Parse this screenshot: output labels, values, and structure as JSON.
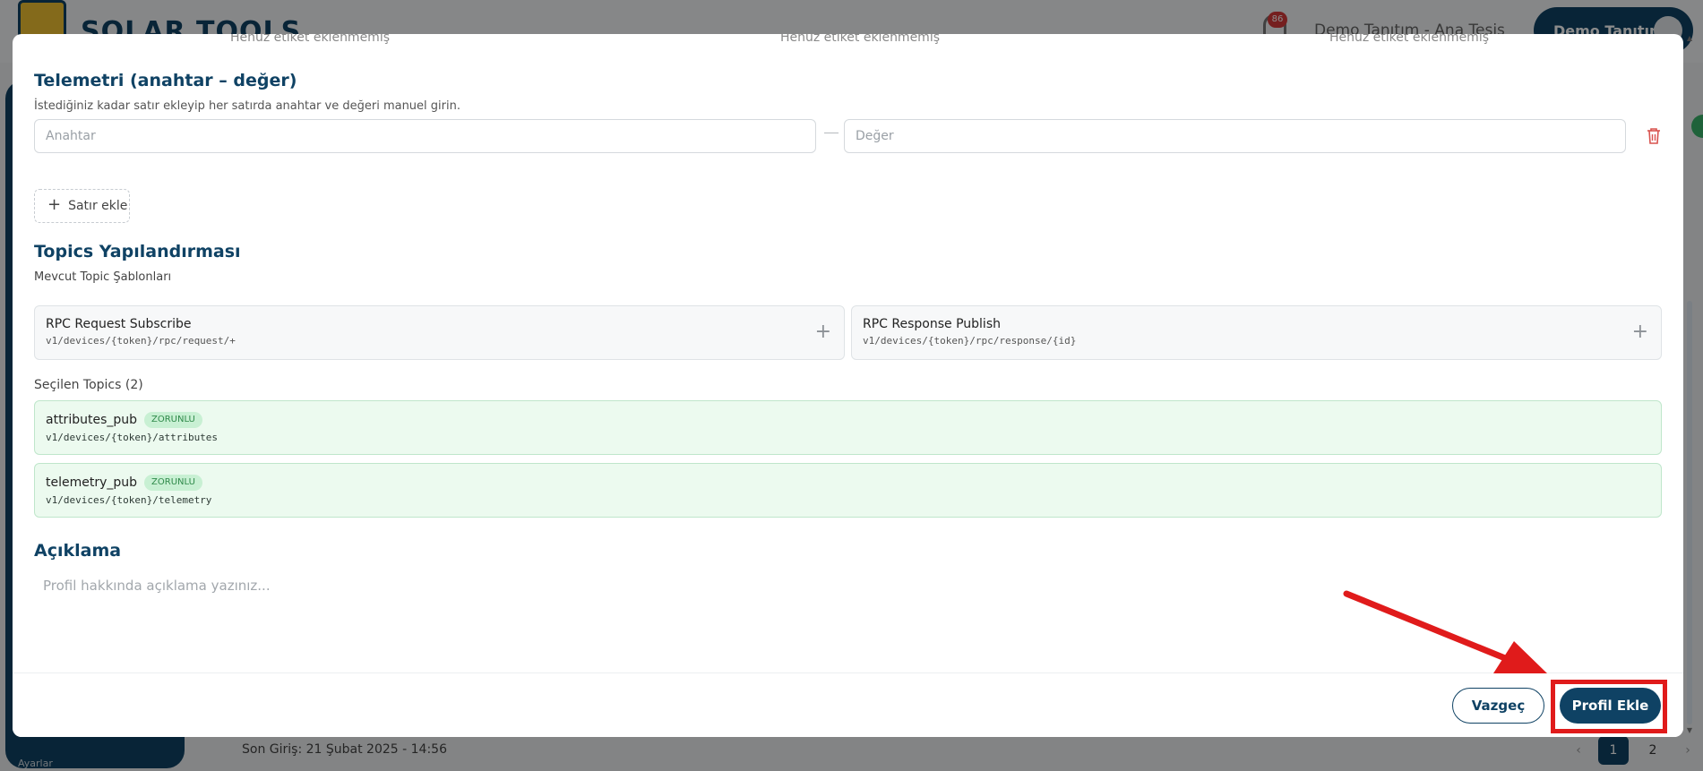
{
  "background": {
    "logo_text": "SOLAR TOOLS",
    "notification_count": "86",
    "site_selector": "Demo Tanıtım - Ana Tesis",
    "user_name": "Demo Tanıtım",
    "sidebar_label": "Ayarlar",
    "last_login": "Son Giriş: 21 Şubat 2025 - 14:56",
    "pagination": {
      "prev": "‹",
      "pages": [
        "1",
        "2"
      ],
      "next": "›"
    }
  },
  "modal": {
    "tag_hints": [
      "Henüz etiket eklenmemiş",
      "Henüz etiket eklenmemiş",
      "Henüz etiket eklenmemiş"
    ],
    "telemetry": {
      "title": "Telemetri (anahtar – değer)",
      "description": "İstediğiniz kadar satır ekleyip her satırda anahtar ve değeri manuel girin.",
      "key_placeholder": "Anahtar",
      "value_placeholder": "Değer",
      "add_row_label": "Satır ekle"
    },
    "topics": {
      "title": "Topics Yapılandırması",
      "templates_label": "Mevcut Topic Şablonları",
      "templates": [
        {
          "name": "RPC Request Subscribe",
          "path": "v1/devices/{token}/rpc/request/+"
        },
        {
          "name": "RPC Response Publish",
          "path": "v1/devices/{token}/rpc/response/{id}"
        }
      ],
      "selected_label": "Seçilen Topics (2)",
      "selected": [
        {
          "name": "attributes_pub",
          "badge": "ZORUNLU",
          "path": "v1/devices/{token}/attributes"
        },
        {
          "name": "telemetry_pub",
          "badge": "ZORUNLU",
          "path": "v1/devices/{token}/telemetry"
        }
      ]
    },
    "description_section": {
      "title": "Açıklama",
      "placeholder": "Profil hakkında açıklama yazınız..."
    },
    "footer": {
      "cancel_label": "Vazgeç",
      "submit_label": "Profil Ekle"
    }
  },
  "colors": {
    "primary": "#0f4264",
    "selected_bg": "#ecfaef",
    "badge_bg": "#c8f0d3",
    "annotation": "#e01b1b",
    "delete": "#d9534f"
  }
}
